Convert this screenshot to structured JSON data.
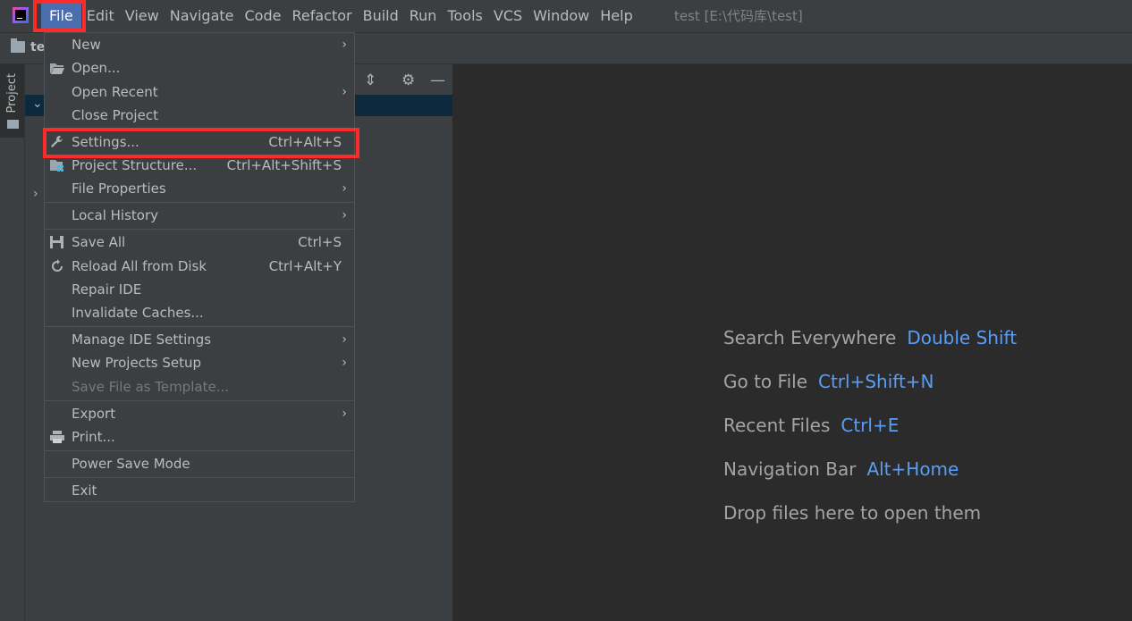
{
  "menubar": {
    "items": [
      "File",
      "Edit",
      "View",
      "Navigate",
      "Code",
      "Refactor",
      "Build",
      "Run",
      "Tools",
      "VCS",
      "Window",
      "Help"
    ],
    "title": "test [E:\\代码库\\test]"
  },
  "navbar": {
    "label": "te"
  },
  "toolwindow": {
    "label": "Project"
  },
  "file_menu": {
    "items": [
      {
        "label": "New",
        "shortcut": "",
        "submenu": true,
        "icon": ""
      },
      {
        "label": "Open...",
        "shortcut": "",
        "submenu": false,
        "icon": "folder-open-icon"
      },
      {
        "label": "Open Recent",
        "shortcut": "",
        "submenu": true,
        "icon": ""
      },
      {
        "label": "Close Project",
        "shortcut": "",
        "submenu": false,
        "icon": ""
      },
      {
        "label": "Settings...",
        "shortcut": "Ctrl+Alt+S",
        "submenu": false,
        "icon": "wrench-icon"
      },
      {
        "label": "Project Structure...",
        "shortcut": "Ctrl+Alt+Shift+S",
        "submenu": false,
        "icon": "project-structure-icon"
      },
      {
        "label": "File Properties",
        "shortcut": "",
        "submenu": true,
        "icon": ""
      },
      {
        "label": "Local History",
        "shortcut": "",
        "submenu": true,
        "icon": ""
      },
      {
        "label": "Save All",
        "shortcut": "Ctrl+S",
        "submenu": false,
        "icon": "save-icon"
      },
      {
        "label": "Reload All from Disk",
        "shortcut": "Ctrl+Alt+Y",
        "submenu": false,
        "icon": "reload-icon"
      },
      {
        "label": "Repair IDE",
        "shortcut": "",
        "submenu": false,
        "icon": ""
      },
      {
        "label": "Invalidate Caches...",
        "shortcut": "",
        "submenu": false,
        "icon": ""
      },
      {
        "label": "Manage IDE Settings",
        "shortcut": "",
        "submenu": true,
        "icon": ""
      },
      {
        "label": "New Projects Setup",
        "shortcut": "",
        "submenu": true,
        "icon": ""
      },
      {
        "label": "Save File as Template...",
        "shortcut": "",
        "submenu": false,
        "icon": "",
        "disabled": true
      },
      {
        "label": "Export",
        "shortcut": "",
        "submenu": true,
        "icon": ""
      },
      {
        "label": "Print...",
        "shortcut": "",
        "submenu": false,
        "icon": "printer-icon"
      },
      {
        "label": "Power Save Mode",
        "shortcut": "",
        "submenu": false,
        "icon": ""
      },
      {
        "label": "Exit",
        "shortcut": "",
        "submenu": false,
        "icon": ""
      }
    ]
  },
  "editor_hints": [
    {
      "label": "Search Everywhere",
      "key": "Double Shift"
    },
    {
      "label": "Go to File",
      "key": "Ctrl+Shift+N"
    },
    {
      "label": "Recent Files",
      "key": "Ctrl+E"
    },
    {
      "label": "Navigation Bar",
      "key": "Alt+Home"
    },
    {
      "label": "Drop files here to open them",
      "key": ""
    }
  ],
  "colors": {
    "menu_active": "#4b6eaf",
    "hint_key": "#589df6",
    "highlight_box": "#ff2b2b"
  }
}
